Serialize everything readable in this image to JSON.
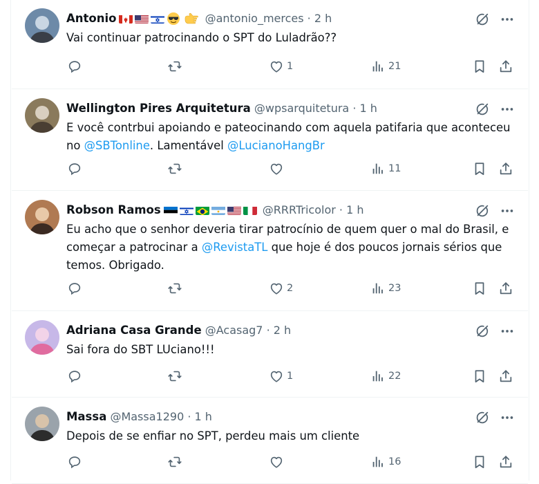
{
  "tweets": [
    {
      "name": "Antonio",
      "flags": [
        "flag-canada",
        "flag-usa",
        "flag-israel",
        "emoji-sunglasses",
        "emoji-pointing-right"
      ],
      "handle": "@antonio_merces",
      "time": "2 h",
      "text": [
        {
          "t": "Vai continuar patrocinando o SPT do Luladrão??"
        }
      ],
      "likes": "1",
      "views": "21",
      "avatar_colors": [
        "#6d8aa8",
        "#c9d6e3",
        "#3a3f47"
      ]
    },
    {
      "name": "Wellington Pires Arquitetura",
      "flags": [],
      "handle": "@wpsarquitetura",
      "time": "1 h",
      "text": [
        {
          "t": "E você contrbui apoiando e pateocinando com aquela patifaria que aconteceu no "
        },
        {
          "t": "@SBTonline",
          "m": true
        },
        {
          "t": ". Lamentável "
        },
        {
          "t": "@LucianoHangBr",
          "m": true
        }
      ],
      "likes": "",
      "views": "11",
      "avatar_colors": [
        "#8a7a5c",
        "#d9cfc0",
        "#4a3f33"
      ]
    },
    {
      "name": "Robson Ramos",
      "flags": [
        "flag-estonia",
        "flag-israel",
        "flag-brazil",
        "flag-argentina",
        "flag-usa",
        "flag-italy"
      ],
      "handle": "@RRRTricolor",
      "time": "1 h",
      "text": [
        {
          "t": "Eu acho que o senhor deveria tirar patrocínio de quem quer o mal do Brasil, e começar a patrocinar a "
        },
        {
          "t": "@RevistaTL",
          "m": true
        },
        {
          "t": " que hoje é dos poucos jornais sérios que temos. Obrigado."
        }
      ],
      "likes": "2",
      "views": "23",
      "avatar_colors": [
        "#b07a52",
        "#e8c9a8",
        "#3b2a22"
      ]
    },
    {
      "name": "Adriana Casa Grande",
      "flags": [],
      "handle": "@Acasag7",
      "time": "2 h",
      "text": [
        {
          "t": "Sai fora do SBT LUciano!!!"
        }
      ],
      "likes": "1",
      "views": "22",
      "avatar_colors": [
        "#c7b8e8",
        "#f2d3e8",
        "#e06c9f"
      ]
    },
    {
      "name": "Massa",
      "flags": [],
      "handle": "@Massa1290",
      "time": "1 h",
      "text": [
        {
          "t": "Depois de se enfiar no SPT, perdeu mais um cliente"
        }
      ],
      "likes": "",
      "views": "16",
      "avatar_colors": [
        "#9aa3ab",
        "#d8c3aa",
        "#2c2c2c"
      ]
    }
  ],
  "icons": {
    "reply": "reply-icon",
    "retweet": "retweet-icon",
    "like": "heart-icon",
    "views": "views-chart-icon",
    "bookmark": "bookmark-icon",
    "share": "share-icon",
    "grok": "grok-icon",
    "more": "more-icon"
  },
  "colors": {
    "text": "#0f1419",
    "secondary": "#536471",
    "mention": "#1d9bf0",
    "border": "#eff3f4"
  }
}
